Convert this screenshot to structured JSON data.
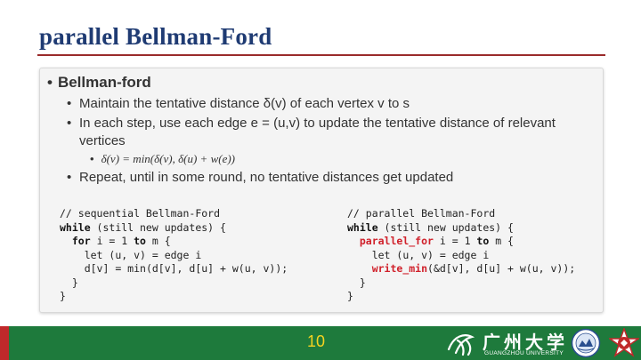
{
  "slide": {
    "title": "parallel Bellman-Ford",
    "page_number": "10"
  },
  "content": {
    "heading": "Bellman-ford",
    "bullet1": "Maintain the tentative distance δ(v) of each vertex v to s",
    "bullet2": "In each step, use each edge e = (u,v) to update the tentative distance of relevant vertices",
    "formula": "δ(v) = min(δ(v), δ(u) + w(e))",
    "bullet3": "Repeat, until in some round, no tentative distances get updated"
  },
  "code_left": {
    "l1": "// sequential Bellman-Ford",
    "l2_kw": "while",
    "l2_rest": " (still new updates) {",
    "l3_kw": "for",
    "l3_a": " i = 1 ",
    "l3_kw2": "to",
    "l3_b": " m {",
    "l4": "let (u, v) = edge i",
    "l5": "d[v] = min(d[v], d[u] + w(u, v));",
    "l6": "}",
    "l7": "}"
  },
  "code_right": {
    "l1": "// parallel Bellman-Ford",
    "l2_kw": "while",
    "l2_rest": " (still new updates) {",
    "l3_hl": "parallel_for",
    "l3_a": " i = 1 ",
    "l3_kw2": "to",
    "l3_b": " m {",
    "l4": "let (u, v) = edge i",
    "l5_hl": "write_min",
    "l5_rest": "(&d[v], d[u] + w(u, v));",
    "l6": "}",
    "l7": "}"
  },
  "footer": {
    "university_name_cn": "广州大学",
    "university_name_en": "GUANGZHOU UNIVERSITY"
  },
  "colors": {
    "title": "#1f3b73",
    "footer_green": "#1e7a3c",
    "highlight_red": "#d0202a",
    "page_number": "#f5d320"
  }
}
